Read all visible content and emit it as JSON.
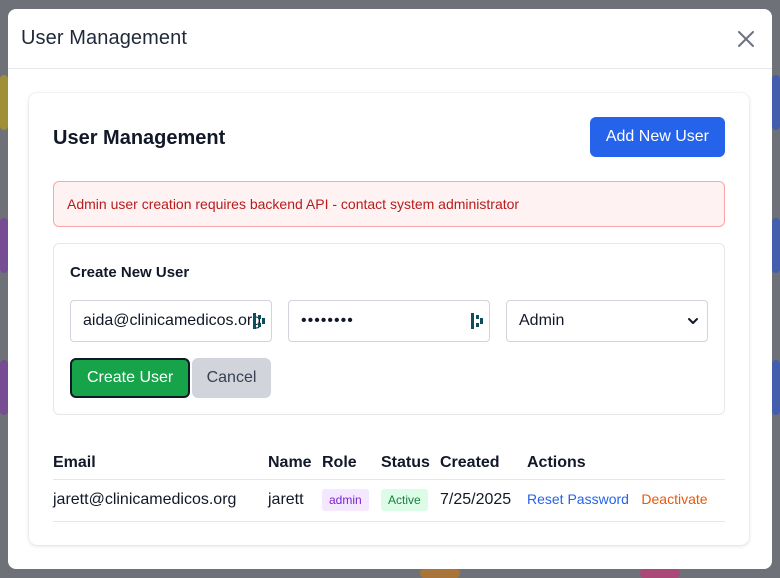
{
  "modal": {
    "title": "User Management"
  },
  "panel": {
    "title": "User Management",
    "add_button_label": "Add New User",
    "alert_message": "Admin user creation requires backend API - contact system administrator"
  },
  "create_form": {
    "title": "Create New User",
    "email_value": "aida@clinicamedicos.org",
    "password_value": "••••••••",
    "role_selected": "Admin",
    "submit_label": "Create User",
    "cancel_label": "Cancel"
  },
  "table": {
    "headers": [
      "Email",
      "Name",
      "Role",
      "Status",
      "Created",
      "Actions"
    ],
    "rows": [
      {
        "email": "jarett@clinicamedicos.org",
        "name": "jarett",
        "role": "admin",
        "status": "Active",
        "created": "7/25/2025",
        "actions": [
          "Reset Password",
          "Deactivate"
        ]
      }
    ]
  },
  "icons": {
    "close": "close-icon",
    "password_manager": "password-manager-icon",
    "select_chevron": "chevron-down-icon"
  },
  "colors": {
    "primary": "#2563eb",
    "success": "#16a34a",
    "danger_text": "#b91c1c",
    "danger_bg": "#fef2f2",
    "role_badge_bg": "#f3e8ff",
    "status_badge_bg": "#dcfce7",
    "warning_link": "#ea580c"
  }
}
